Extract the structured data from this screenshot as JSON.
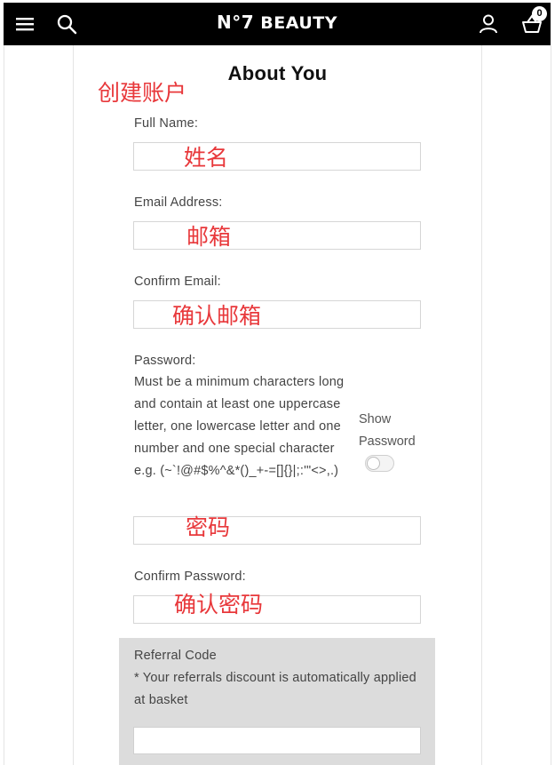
{
  "header": {
    "logo_prefix": "N°7",
    "logo_text": " BEAUTY",
    "basket_count": "0"
  },
  "form": {
    "title": "About You",
    "full_name_label": "Full Name:",
    "email_label": "Email Address:",
    "confirm_email_label": "Confirm Email:",
    "password_label": "Password:",
    "password_help": "Must be a minimum characters long and contain at least one uppercase letter, one lowercase letter and one number and one special character e.g. (~`!@#$%^&*()_+-=[]{}|;:'\"<>,.)",
    "show_password_label": "Show Password",
    "confirm_password_label": "Confirm Password:",
    "referral_label": "Referral Code",
    "referral_note": "* Your referrals discount is automatically applied at basket"
  },
  "annotations": {
    "create_account": "创建账户",
    "name": "姓名",
    "email": "邮箱",
    "confirm_email": "确认邮箱",
    "password": "密码",
    "confirm_password": "确认密码"
  },
  "colors": {
    "header_bg": "#000000",
    "annotation": "#e8383b",
    "referral_bg": "#dcdcdc"
  },
  "icons": {
    "menu": "hamburger-menu-icon",
    "search": "search-icon",
    "account": "user-icon",
    "basket": "basket-icon"
  }
}
